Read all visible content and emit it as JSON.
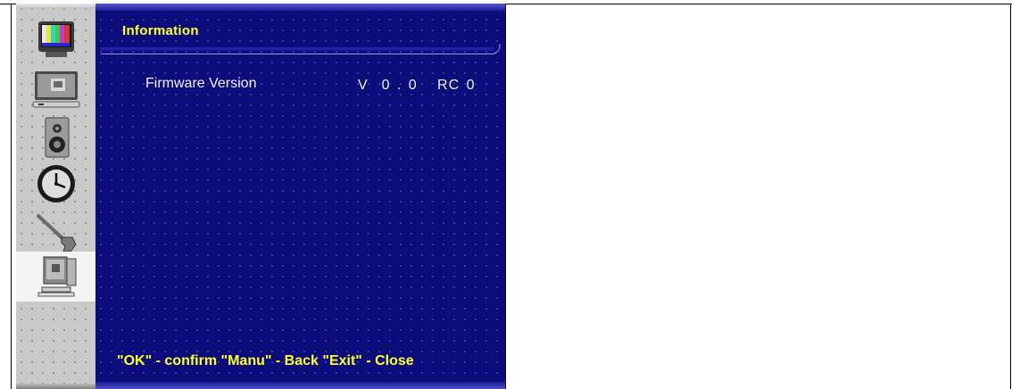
{
  "menu": {
    "title": "Information",
    "rows": [
      {
        "label": "Firmware Version",
        "value": "V  0 . 0   RC 0"
      }
    ],
    "footer": "\"OK\" - confirm \"Manu\" - Back \"Exit\" - Close"
  },
  "sidebar": {
    "items": [
      {
        "icon": "tv-color-bars-icon"
      },
      {
        "icon": "monitor-screen-icon"
      },
      {
        "icon": "speaker-icon"
      },
      {
        "icon": "clock-icon"
      },
      {
        "icon": "wrench-icon"
      },
      {
        "icon": "computer-info-icon",
        "selected": true
      }
    ]
  },
  "colors": {
    "panel_bg": "#0c0c7a",
    "accent_text": "#ffff33",
    "sidebar_bg": "#c9c9c9"
  }
}
